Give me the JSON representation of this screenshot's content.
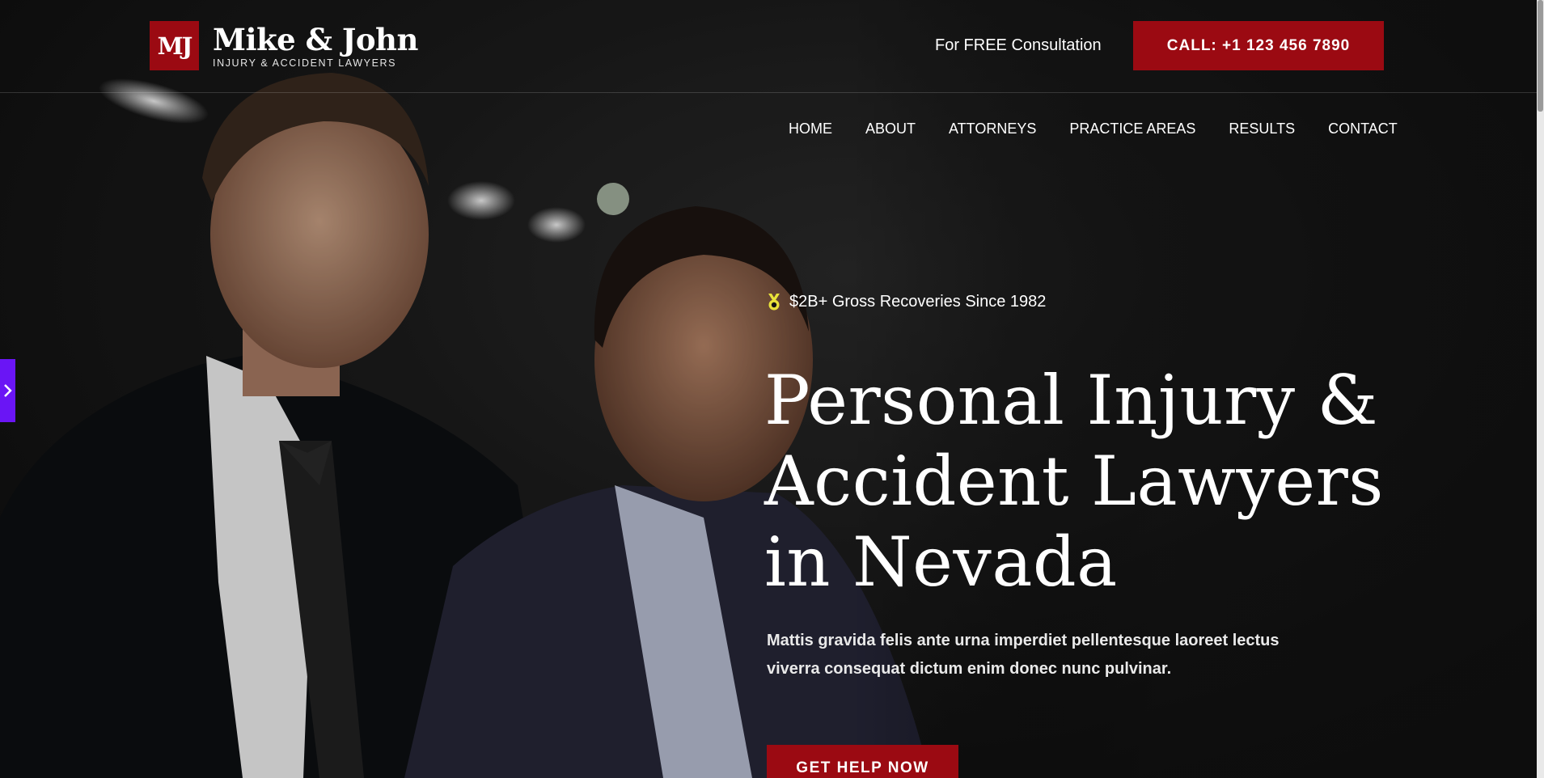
{
  "brand": {
    "monogram": "MJ",
    "name": "Mike & John",
    "tagline": "INJURY & ACCIDENT LAWYERS",
    "accent_color": "#9b0a12"
  },
  "header": {
    "consultation_text": "For FREE Consultation",
    "call_button": "CALL: +1 123 456 7890"
  },
  "nav": {
    "items": [
      {
        "label": "HOME"
      },
      {
        "label": "ABOUT"
      },
      {
        "label": "ATTORNEYS"
      },
      {
        "label": "PRACTICE AREAS"
      },
      {
        "label": "RESULTS"
      },
      {
        "label": "CONTACT"
      }
    ]
  },
  "hero": {
    "badge_icon": "medal-icon",
    "badge_text": "$2B+ Gross Recoveries Since 1982",
    "headline_line1": "Personal Injury &",
    "headline_line2": "Accident Lawyers",
    "headline_line3": "in Nevada",
    "description_line1": "Mattis gravida felis ante urna imperdiet pellentesque laoreet lectus",
    "description_line2": "viverra consequat dictum enim donec nunc pulvinar.",
    "cta_label": "GET HELP NOW"
  },
  "side_tab": {
    "icon": "chevron-right-icon",
    "color": "#6a15f5"
  }
}
